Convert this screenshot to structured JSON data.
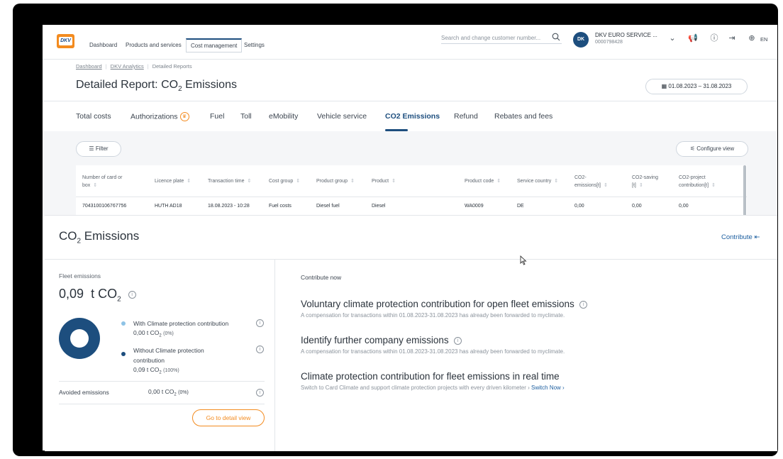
{
  "topnav": {
    "logo": "DKV",
    "items": [
      "Dashboard",
      "Products and services",
      "Cost management",
      "Settings"
    ],
    "search_placeholder": "Search and change customer number...",
    "avatar": "DK",
    "account_name": "DKV EURO SERVICE ...",
    "account_number": "0000798428",
    "language": "EN"
  },
  "report": {
    "breadcrumb": [
      "Dashboard",
      "DKV Analytics",
      "Detailed Reports"
    ],
    "title_prefix": "Detailed Report: CO",
    "title_sub": "2",
    "title_suffix": " Emissions",
    "date_range": "01.08.2023 – 31.08.2023"
  },
  "tabs": [
    "Total costs",
    "Authorizations",
    "Fuel",
    "Toll",
    "eMobility",
    "Vehicle service",
    "CO2 Emissions",
    "Refund",
    "Rebates and fees"
  ],
  "table": {
    "filter_label": "Filter",
    "configure_label": "Configure view",
    "headers": [
      "Number of card or box",
      "Licence plate",
      "Transaction time",
      "Cost group",
      "Product group",
      "Product",
      "Product code",
      "Service country",
      "CO2-emissions[t]",
      "CO2-saving [t]",
      "CO2-project contribution[t]"
    ],
    "row": [
      "7043100106767756",
      "HUTH AD18",
      "18.08.2023 - 10:28",
      "Fuel costs",
      "Diesel fuel",
      "Diesel",
      "WA0009",
      "DE",
      "0,00",
      "0,00",
      "0,00"
    ]
  },
  "panel": {
    "title_prefix": "CO",
    "title_sub": "2",
    "title_suffix": " Emissions",
    "contribute_link": "Contribute",
    "fleet_label": "Fleet emissions",
    "fleet_value": "0,09",
    "fleet_unit_prefix": "t CO",
    "fleet_unit_sub": "2",
    "legend_with": "With Climate protection contribution",
    "legend_with_value": "0,00 t CO",
    "legend_with_pct": "(0%)",
    "legend_without_1": "Without Climate protection",
    "legend_without_2": "contribution",
    "legend_without_value": "0,09 t CO",
    "legend_without_pct": "(100%)",
    "avoided_label": "Avoided emissions",
    "avoided_value": "0,00 t CO",
    "avoided_pct": "(0%)",
    "detail_button": "Go to detail view",
    "contribute_now": "Contribute now",
    "sections": [
      {
        "title": "Voluntary climate protection contribution for open fleet emissions",
        "sub": "A compensation for transactions within 01.08.2023-31.08.2023 has already been forwarded to myclimate."
      },
      {
        "title": "Identify further company emissions",
        "sub": "A compensation for transactions within 01.08.2023-31.08.2023 has already been forwarded to myclimate."
      },
      {
        "title": "Climate protection contribution for fleet emissions in real time",
        "sub": "Switch to Card Climate and support climate protection projects with every driven kilometer ›",
        "link": "Switch Now ›"
      }
    ],
    "donut": {
      "with_pct": 0,
      "without_pct": 100,
      "color_with": "#8ec3e6",
      "color_without": "#1d4e7e"
    }
  },
  "colors": {
    "primary": "#1d4e7e",
    "accent": "#f38b1f",
    "link": "#1d5fa0"
  }
}
